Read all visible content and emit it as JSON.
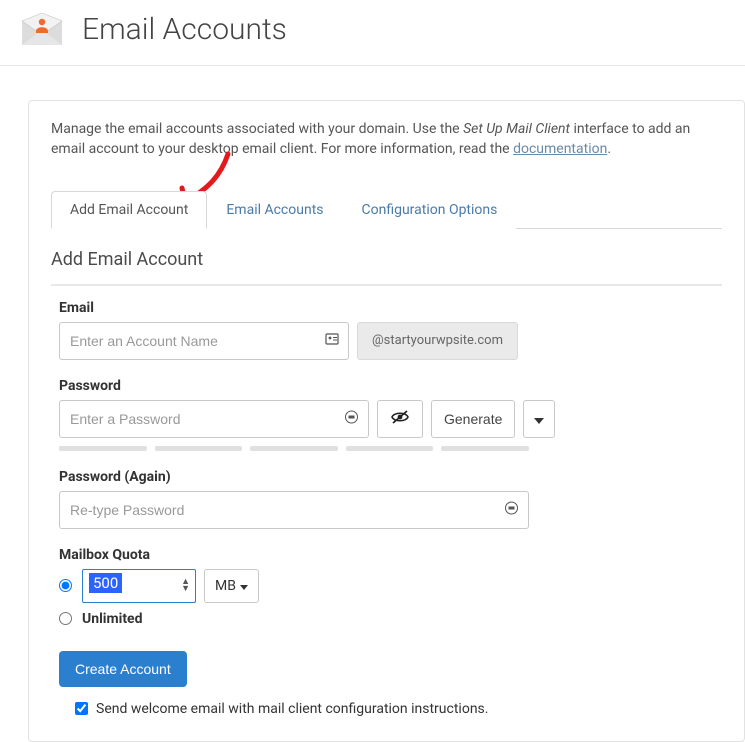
{
  "header": {
    "title": "Email Accounts"
  },
  "intro": {
    "text_pre": "Manage the email accounts associated with your domain. Use the ",
    "italic": "Set Up Mail Client",
    "text_mid": " interface to add an email account to your desktop email client. For more information, read the ",
    "link": "documentation",
    "text_post": "."
  },
  "tabs": {
    "add": "Add Email Account",
    "list": "Email Accounts",
    "config": "Configuration Options"
  },
  "section": {
    "title": "Add Email Account"
  },
  "form": {
    "email": {
      "label": "Email",
      "placeholder": "Enter an Account Name",
      "domain": "@startyourwpsite.com"
    },
    "password": {
      "label": "Password",
      "placeholder": "Enter a Password",
      "generate_label": "Generate"
    },
    "password_again": {
      "label": "Password (Again)",
      "placeholder": "Re-type Password"
    },
    "quota": {
      "label": "Mailbox Quota",
      "value": "500",
      "unit": "MB",
      "unlimited": "Unlimited"
    },
    "create_label": "Create Account",
    "welcome_label": "Send welcome email with mail client configuration instructions."
  }
}
